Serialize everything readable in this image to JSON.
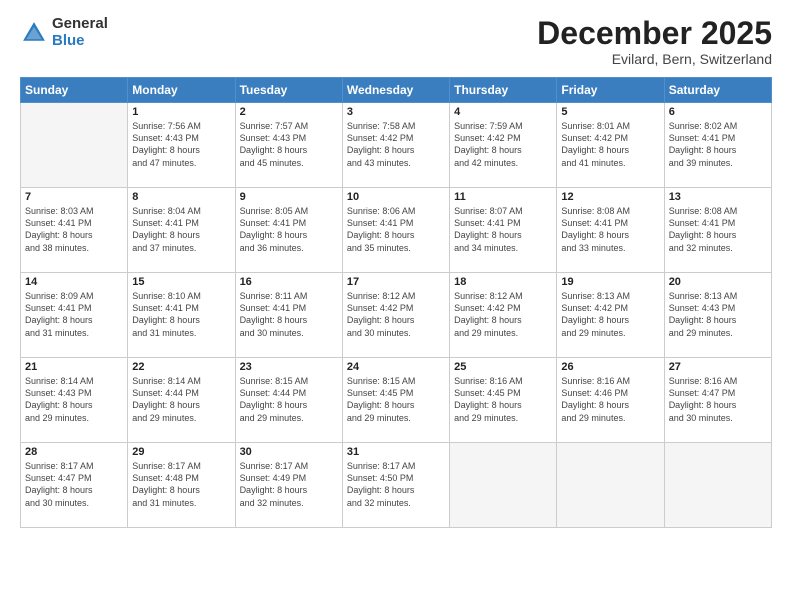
{
  "header": {
    "logo_general": "General",
    "logo_blue": "Blue",
    "month_title": "December 2025",
    "subtitle": "Evilard, Bern, Switzerland"
  },
  "days_of_week": [
    "Sunday",
    "Monday",
    "Tuesday",
    "Wednesday",
    "Thursday",
    "Friday",
    "Saturday"
  ],
  "weeks": [
    [
      {
        "day": "",
        "info": ""
      },
      {
        "day": "1",
        "info": "Sunrise: 7:56 AM\nSunset: 4:43 PM\nDaylight: 8 hours\nand 47 minutes."
      },
      {
        "day": "2",
        "info": "Sunrise: 7:57 AM\nSunset: 4:43 PM\nDaylight: 8 hours\nand 45 minutes."
      },
      {
        "day": "3",
        "info": "Sunrise: 7:58 AM\nSunset: 4:42 PM\nDaylight: 8 hours\nand 43 minutes."
      },
      {
        "day": "4",
        "info": "Sunrise: 7:59 AM\nSunset: 4:42 PM\nDaylight: 8 hours\nand 42 minutes."
      },
      {
        "day": "5",
        "info": "Sunrise: 8:01 AM\nSunset: 4:42 PM\nDaylight: 8 hours\nand 41 minutes."
      },
      {
        "day": "6",
        "info": "Sunrise: 8:02 AM\nSunset: 4:41 PM\nDaylight: 8 hours\nand 39 minutes."
      }
    ],
    [
      {
        "day": "7",
        "info": "Sunrise: 8:03 AM\nSunset: 4:41 PM\nDaylight: 8 hours\nand 38 minutes."
      },
      {
        "day": "8",
        "info": "Sunrise: 8:04 AM\nSunset: 4:41 PM\nDaylight: 8 hours\nand 37 minutes."
      },
      {
        "day": "9",
        "info": "Sunrise: 8:05 AM\nSunset: 4:41 PM\nDaylight: 8 hours\nand 36 minutes."
      },
      {
        "day": "10",
        "info": "Sunrise: 8:06 AM\nSunset: 4:41 PM\nDaylight: 8 hours\nand 35 minutes."
      },
      {
        "day": "11",
        "info": "Sunrise: 8:07 AM\nSunset: 4:41 PM\nDaylight: 8 hours\nand 34 minutes."
      },
      {
        "day": "12",
        "info": "Sunrise: 8:08 AM\nSunset: 4:41 PM\nDaylight: 8 hours\nand 33 minutes."
      },
      {
        "day": "13",
        "info": "Sunrise: 8:08 AM\nSunset: 4:41 PM\nDaylight: 8 hours\nand 32 minutes."
      }
    ],
    [
      {
        "day": "14",
        "info": "Sunrise: 8:09 AM\nSunset: 4:41 PM\nDaylight: 8 hours\nand 31 minutes."
      },
      {
        "day": "15",
        "info": "Sunrise: 8:10 AM\nSunset: 4:41 PM\nDaylight: 8 hours\nand 31 minutes."
      },
      {
        "day": "16",
        "info": "Sunrise: 8:11 AM\nSunset: 4:41 PM\nDaylight: 8 hours\nand 30 minutes."
      },
      {
        "day": "17",
        "info": "Sunrise: 8:12 AM\nSunset: 4:42 PM\nDaylight: 8 hours\nand 30 minutes."
      },
      {
        "day": "18",
        "info": "Sunrise: 8:12 AM\nSunset: 4:42 PM\nDaylight: 8 hours\nand 29 minutes."
      },
      {
        "day": "19",
        "info": "Sunrise: 8:13 AM\nSunset: 4:42 PM\nDaylight: 8 hours\nand 29 minutes."
      },
      {
        "day": "20",
        "info": "Sunrise: 8:13 AM\nSunset: 4:43 PM\nDaylight: 8 hours\nand 29 minutes."
      }
    ],
    [
      {
        "day": "21",
        "info": "Sunrise: 8:14 AM\nSunset: 4:43 PM\nDaylight: 8 hours\nand 29 minutes."
      },
      {
        "day": "22",
        "info": "Sunrise: 8:14 AM\nSunset: 4:44 PM\nDaylight: 8 hours\nand 29 minutes."
      },
      {
        "day": "23",
        "info": "Sunrise: 8:15 AM\nSunset: 4:44 PM\nDaylight: 8 hours\nand 29 minutes."
      },
      {
        "day": "24",
        "info": "Sunrise: 8:15 AM\nSunset: 4:45 PM\nDaylight: 8 hours\nand 29 minutes."
      },
      {
        "day": "25",
        "info": "Sunrise: 8:16 AM\nSunset: 4:45 PM\nDaylight: 8 hours\nand 29 minutes."
      },
      {
        "day": "26",
        "info": "Sunrise: 8:16 AM\nSunset: 4:46 PM\nDaylight: 8 hours\nand 29 minutes."
      },
      {
        "day": "27",
        "info": "Sunrise: 8:16 AM\nSunset: 4:47 PM\nDaylight: 8 hours\nand 30 minutes."
      }
    ],
    [
      {
        "day": "28",
        "info": "Sunrise: 8:17 AM\nSunset: 4:47 PM\nDaylight: 8 hours\nand 30 minutes."
      },
      {
        "day": "29",
        "info": "Sunrise: 8:17 AM\nSunset: 4:48 PM\nDaylight: 8 hours\nand 31 minutes."
      },
      {
        "day": "30",
        "info": "Sunrise: 8:17 AM\nSunset: 4:49 PM\nDaylight: 8 hours\nand 32 minutes."
      },
      {
        "day": "31",
        "info": "Sunrise: 8:17 AM\nSunset: 4:50 PM\nDaylight: 8 hours\nand 32 minutes."
      },
      {
        "day": "",
        "info": ""
      },
      {
        "day": "",
        "info": ""
      },
      {
        "day": "",
        "info": ""
      }
    ]
  ]
}
